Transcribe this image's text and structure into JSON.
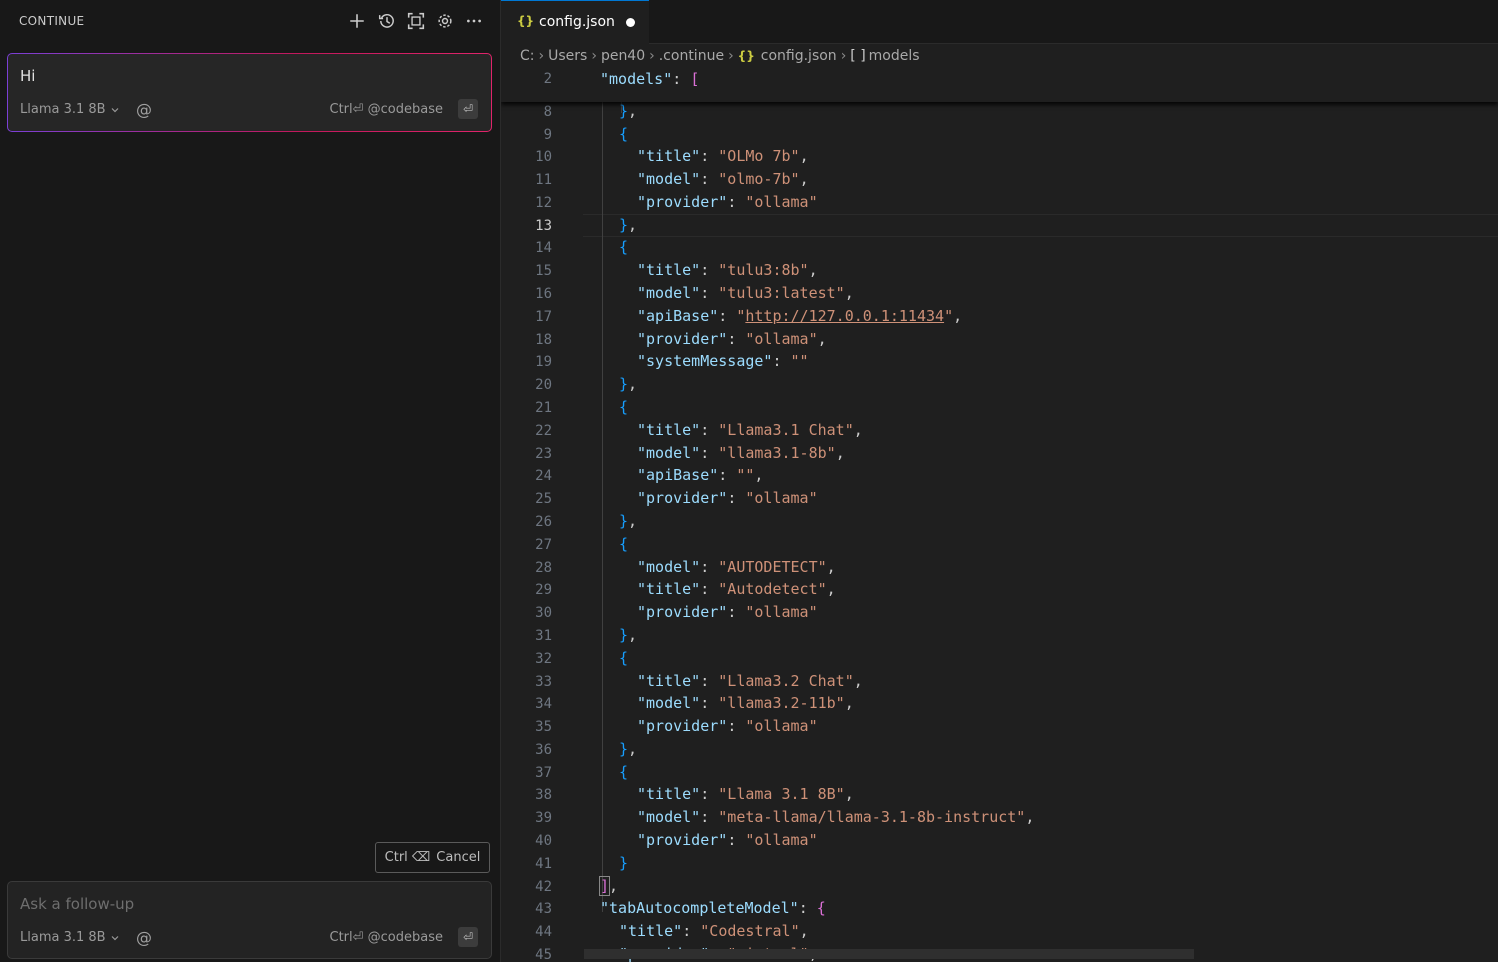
{
  "panel": {
    "title": "CONTINUE",
    "icons": [
      "plus-icon",
      "history-icon",
      "fullscreen-icon",
      "gear-icon",
      "more-icon"
    ]
  },
  "message": {
    "text": "Hi",
    "model": "Llama 3.1 8B",
    "at_symbol": "@",
    "hint": "Ctrl⏎ @codebase",
    "enter_glyph": "⏎"
  },
  "cancel": {
    "keys": "Ctrl ⌫",
    "label": "Cancel"
  },
  "followup": {
    "placeholder": "Ask a follow-up",
    "model": "Llama 3.1 8B",
    "at_symbol": "@",
    "hint": "Ctrl⏎ @codebase",
    "enter_glyph": "⏎"
  },
  "tab": {
    "icon_glyph": "{}",
    "label": "config.json"
  },
  "breadcrumb": {
    "items": [
      "C:",
      "Users",
      "pen40",
      ".continue",
      "config.json",
      "models"
    ],
    "json_glyph": "{}",
    "array_glyph": "[ ]"
  },
  "editor": {
    "sticky_line_number": "2",
    "active_line": "13",
    "lines": [
      {
        "n": "8",
        "t": "},"
      },
      {
        "n": "9",
        "t": "{"
      },
      {
        "n": "10",
        "t": "title: OLMo 7b"
      },
      {
        "n": "11",
        "t": "model: olmo-7b"
      },
      {
        "n": "12",
        "t": "provider: ollama"
      },
      {
        "n": "13",
        "t": "},"
      },
      {
        "n": "14",
        "t": "{"
      },
      {
        "n": "15",
        "t": "title: tulu3:8b"
      },
      {
        "n": "16",
        "t": "model: tulu3:latest"
      },
      {
        "n": "17",
        "t": "apiBase: http://127.0.0.1:11434"
      },
      {
        "n": "18",
        "t": "provider: ollama"
      },
      {
        "n": "19",
        "t": "systemMessage"
      },
      {
        "n": "20",
        "t": "},"
      },
      {
        "n": "21",
        "t": "{"
      },
      {
        "n": "22",
        "t": "title: Llama3.1 Chat"
      },
      {
        "n": "23",
        "t": "model: llama3.1-8b"
      },
      {
        "n": "24",
        "t": "apiBase"
      },
      {
        "n": "25",
        "t": "provider: ollama"
      },
      {
        "n": "26",
        "t": "},"
      },
      {
        "n": "27",
        "t": "{"
      },
      {
        "n": "28",
        "t": "model: AUTODETECT"
      },
      {
        "n": "29",
        "t": "title: Autodetect"
      },
      {
        "n": "30",
        "t": "provider: ollama"
      },
      {
        "n": "31",
        "t": "},"
      },
      {
        "n": "32",
        "t": "{"
      },
      {
        "n": "33",
        "t": "title: Llama3.2 Chat"
      },
      {
        "n": "34",
        "t": "model: llama3.2-11b"
      },
      {
        "n": "35",
        "t": "provider: ollama"
      },
      {
        "n": "36",
        "t": "},"
      },
      {
        "n": "37",
        "t": "{"
      },
      {
        "n": "38",
        "t": "title: Llama 3.1 8B"
      },
      {
        "n": "39",
        "t": "model: meta-llama/llama-3.1-8b-instruct"
      },
      {
        "n": "40",
        "t": "provider: ollama"
      },
      {
        "n": "41",
        "t": "}"
      },
      {
        "n": "42",
        "t": "],"
      },
      {
        "n": "43",
        "t": "tabAutocompleteModel"
      },
      {
        "n": "44",
        "t": "title: Codestral"
      },
      {
        "n": "45",
        "t": "provider: mistral"
      }
    ]
  },
  "colors": {
    "key": "#9cdcfe",
    "string": "#ce9178",
    "bracket_level0": "#ffd700",
    "bracket_level1": "#da70d6",
    "bracket_level2": "#179fff",
    "accent": "#0078d4"
  }
}
